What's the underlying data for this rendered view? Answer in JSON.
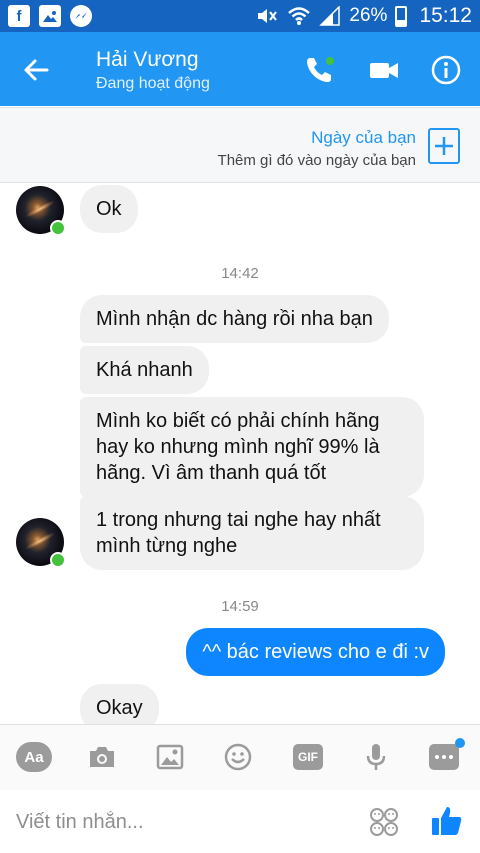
{
  "status_bar": {
    "apps": [
      {
        "icon": "facebook-icon",
        "glyph": "f"
      },
      {
        "icon": "gallery-icon",
        "glyph": ""
      },
      {
        "icon": "messenger-icon",
        "glyph": ""
      }
    ],
    "battery": "26%",
    "time": "15:12"
  },
  "header": {
    "name": "Hải Vương",
    "status": "Đang hoạt động",
    "colors": {
      "bar": "#2196f3",
      "status_bar": "#1565c0"
    }
  },
  "day_banner": {
    "title": "Ngày của bạn",
    "subtitle": "Thêm gì đó vào ngày của bạn"
  },
  "messages": {
    "m1": "Ok",
    "t1": "14:42",
    "m2": "Mình nhận dc hàng rồi nha bạn",
    "m3": "Khá nhanh",
    "m4": "Mình ko biết có phải chính hãng hay ko nhưng mình nghĩ 99% là hãng. Vì âm thanh quá tốt",
    "m5": "1 trong nhưng tai nghe hay nhất mình từng nghe",
    "t2": "14:59",
    "m6": "^^ bác reviews cho e đi :v",
    "m7": "Okay"
  },
  "composer": {
    "aa_label": "Aa",
    "gif_label": "GIF",
    "placeholder": "Viết tin nhắn...",
    "accent": "#0d86ff"
  }
}
